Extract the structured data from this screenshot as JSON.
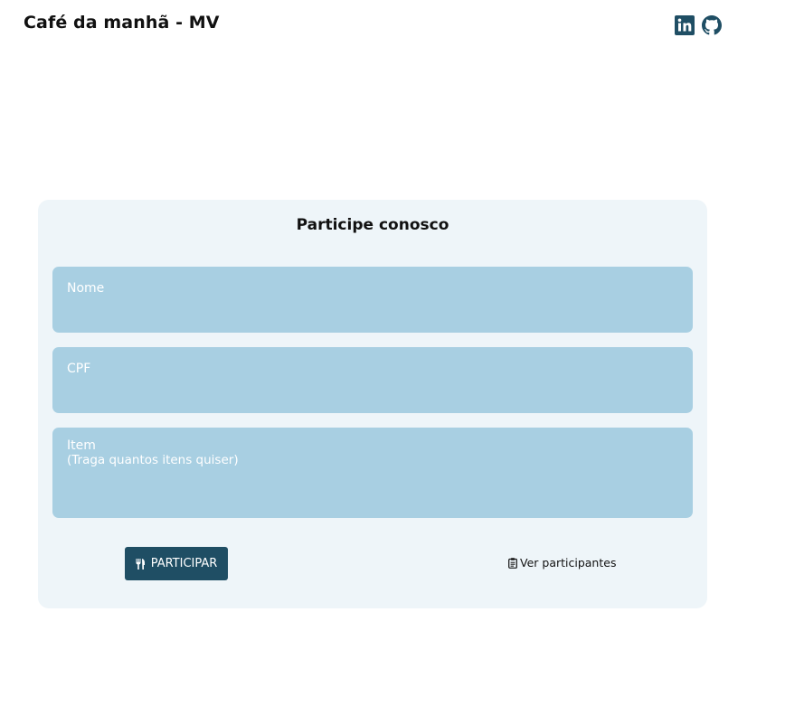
{
  "header": {
    "title": "Café da manhã - MV",
    "social": [
      "linkedin-icon",
      "github-icon"
    ]
  },
  "form": {
    "title": "Participe conosco",
    "fields": [
      {
        "label": "Nome",
        "hint": ""
      },
      {
        "label": "CPF",
        "hint": ""
      },
      {
        "label": "Item",
        "hint": "(Traga quantos itens quiser)"
      }
    ],
    "submit_label": "PARTICIPAR",
    "submit_icon": "utensils-icon",
    "view_link_label": "Ver participantes",
    "view_link_icon": "clipboard-icon"
  },
  "colors": {
    "primary": "#1f4e64",
    "field_bg": "#a8cfe2",
    "card_bg": "#eef5f9"
  }
}
